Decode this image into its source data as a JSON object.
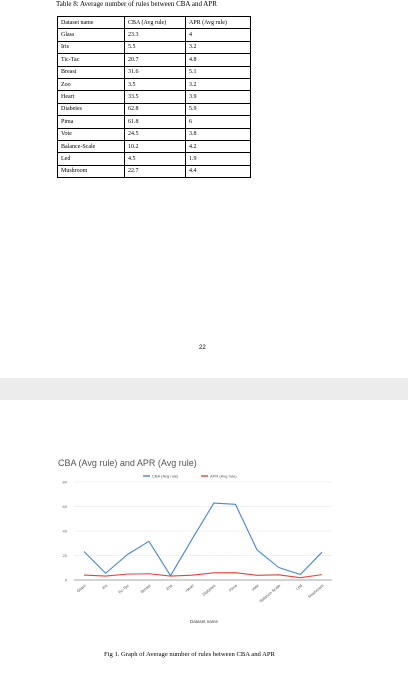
{
  "table": {
    "caption": "Table 8: Average number of rules between CBA and APR",
    "headers": [
      "Dataset name",
      "CBA (Avg rule)",
      "APR (Avg rule)"
    ],
    "rows": [
      [
        "Glass",
        "23.3",
        "4"
      ],
      [
        "Iris",
        "5.5",
        "3.2"
      ],
      [
        "Tic-Tac",
        "20.7",
        "4.8"
      ],
      [
        "Breast",
        "31.6",
        "5.1"
      ],
      [
        "Zoo",
        "3.5",
        "3.2"
      ],
      [
        "Heart",
        "33.5",
        "3.9"
      ],
      [
        "Diabetes",
        "62.8",
        "5.9"
      ],
      [
        "Pima",
        "61.8",
        "6"
      ],
      [
        "Vote",
        "24.5",
        "3.8"
      ],
      [
        "Balance-Scale",
        "10.2",
        "4.2"
      ],
      [
        "Led",
        "4.5",
        "1.9"
      ],
      [
        "Mushroom",
        "22.7",
        "4.4"
      ]
    ]
  },
  "page_number": "22",
  "chart_data": {
    "type": "line",
    "title": "CBA (Avg rule) and APR (Avg rule)",
    "xlabel": "Dataset name",
    "ylabel": "",
    "categories": [
      "Glass",
      "Iris",
      "Tic-Tac",
      "Breast",
      "Zoo",
      "Heart",
      "Diabetes",
      "Pima",
      "Vote",
      "Balance-Scale",
      "Led",
      "Mushroom"
    ],
    "series": [
      {
        "name": "CBA (Avg rule)",
        "color": "#4285f4",
        "values": [
          23.3,
          5.5,
          20.7,
          31.6,
          3.5,
          33.5,
          62.8,
          61.8,
          24.5,
          10.2,
          4.5,
          22.7
        ]
      },
      {
        "name": "APR (Avg rule)",
        "color": "#ea4335",
        "values": [
          4,
          3.2,
          4.8,
          5.1,
          3.2,
          3.9,
          5.9,
          6,
          3.8,
          4.2,
          1.9,
          4.4
        ]
      }
    ],
    "y_ticks": [
      "0",
      "20",
      "40",
      "60",
      "80"
    ],
    "ylim": [
      0,
      80
    ],
    "grid": true,
    "legend_position": "top"
  },
  "figure_caption": "Fig 1. Graph of Average number of rules between CBA and APR"
}
